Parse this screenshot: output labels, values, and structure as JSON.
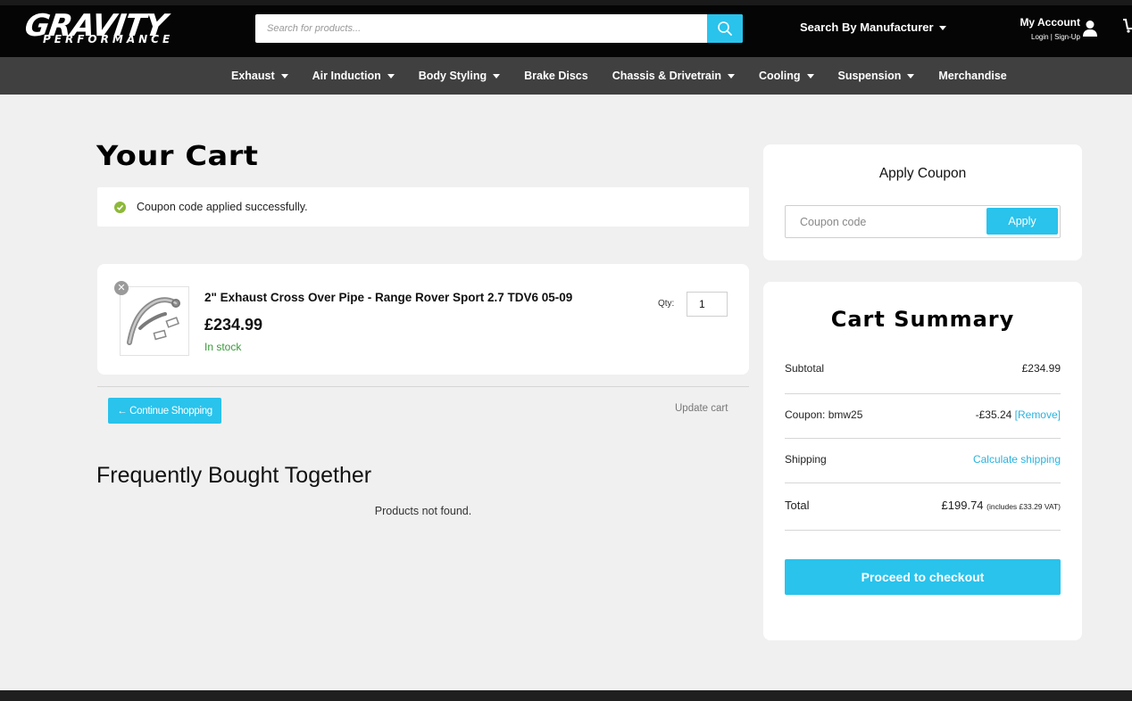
{
  "header": {
    "logo_main": "GRAVITY",
    "logo_sub": "PERFORMANCE",
    "search_placeholder": "Search for products...",
    "manufacturer_label": "Search By Manufacturer",
    "account_title": "My Account",
    "account_sub": "Login | Sign-Up"
  },
  "nav": {
    "items": [
      {
        "label": "Exhaust",
        "dropdown": true
      },
      {
        "label": "Air Induction",
        "dropdown": true
      },
      {
        "label": "Body Styling",
        "dropdown": true
      },
      {
        "label": "Brake Discs",
        "dropdown": false
      },
      {
        "label": "Chassis & Drivetrain",
        "dropdown": true
      },
      {
        "label": "Cooling",
        "dropdown": true
      },
      {
        "label": "Suspension",
        "dropdown": true
      },
      {
        "label": "Merchandise",
        "dropdown": false
      }
    ]
  },
  "cart": {
    "title": "Your Cart",
    "notice": "Coupon code applied successfully.",
    "item": {
      "name": "2\" Exhaust Cross Over Pipe - Range Rover Sport 2.7 TDV6 05-09",
      "price": "£234.99",
      "stock": "In stock",
      "qty_label": "Qty:",
      "qty": "1"
    },
    "continue_label": "← Continue Shopping",
    "update_label": "Update cart"
  },
  "fbt": {
    "title": "Frequently Bought Together",
    "empty": "Products not found."
  },
  "coupon": {
    "title": "Apply Coupon",
    "placeholder": "Coupon code",
    "apply_label": "Apply"
  },
  "summary": {
    "title": "Cart Summary",
    "subtotal_label": "Subtotal",
    "subtotal_value": "£234.99",
    "coupon_label": "Coupon: bmw25",
    "coupon_value": "-£35.24",
    "coupon_remove": "[Remove]",
    "shipping_label": "Shipping",
    "shipping_value": "Calculate shipping",
    "total_label": "Total",
    "total_value": "£199.74",
    "total_vat": "(includes £33.29 VAT)",
    "checkout_label": "Proceed to checkout"
  },
  "colors": {
    "accent": "#29c3ec",
    "header_bg": "#050505",
    "nav_bg": "#404040",
    "page_bg": "#f0f0f0",
    "stock_green": "#3a9a3a"
  },
  "icons": [
    "search-icon",
    "chevron-down-icon",
    "user-icon",
    "cart-icon",
    "check-icon",
    "close-icon"
  ]
}
